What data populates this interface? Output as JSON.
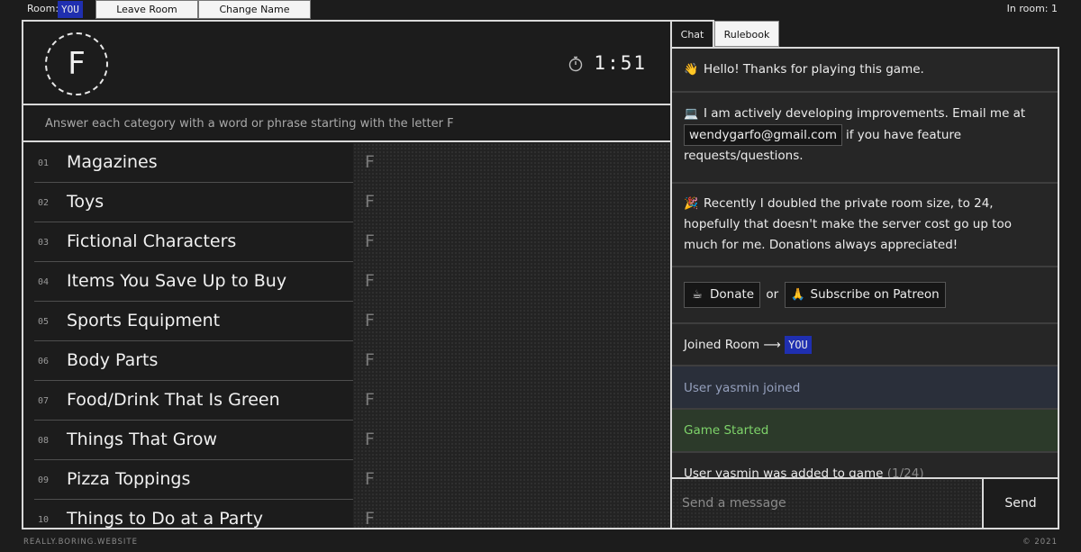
{
  "topbar": {
    "room_label": "Room:",
    "room_name": "YOU",
    "leave_label": "Leave Room",
    "change_name_label": "Change Name",
    "in_room": "In room: 1"
  },
  "game": {
    "letter": "F",
    "timer": "1:51",
    "instructions": "Answer each category with a word or phrase starting with the letter F",
    "categories": [
      {
        "num": "01",
        "name": "Magazines",
        "answer": "F"
      },
      {
        "num": "02",
        "name": "Toys",
        "answer": "F"
      },
      {
        "num": "03",
        "name": "Fictional Characters",
        "answer": "F"
      },
      {
        "num": "04",
        "name": "Items You Save Up to Buy",
        "answer": "F"
      },
      {
        "num": "05",
        "name": "Sports Equipment",
        "answer": "F"
      },
      {
        "num": "06",
        "name": "Body Parts",
        "answer": "F"
      },
      {
        "num": "07",
        "name": "Food/Drink That Is Green",
        "answer": "F"
      },
      {
        "num": "08",
        "name": "Things That Grow",
        "answer": "F"
      },
      {
        "num": "09",
        "name": "Pizza Toppings",
        "answer": "F"
      },
      {
        "num": "10",
        "name": "Things to Do at a Party",
        "answer": "F"
      }
    ]
  },
  "tabs": {
    "chat": "Chat",
    "rulebook": "Rulebook"
  },
  "chat": {
    "hello": "Hello! Thanks for playing this game.",
    "dev_before": "I am actively developing improvements. Email me at",
    "email": "wendygarfo@gmail.com",
    "dev_after": "if you have feature requests/questions.",
    "room_size": "Recently I doubled the private room size, to 24, hopefully that doesn't make the server cost go up too much for me. Donations always appreciated!",
    "donate_label": "Donate",
    "or_text": "or",
    "patreon_label": "Subscribe on Patreon",
    "joined_room": "Joined Room ⟶",
    "joined_room_name": "YOU",
    "user_joined": "User yasmin joined",
    "game_started": "Game Started",
    "user_added": "User yasmin was added to game",
    "user_added_count": "(1/24)"
  },
  "composer": {
    "placeholder": "Send a message",
    "send_label": "Send"
  },
  "footer": {
    "site": "REALLY.BORING.WEBSITE",
    "copyright": "© 2021"
  },
  "colors": {
    "accent_blue": "#1f2fb0",
    "game_started_green": "#7ed36a",
    "joined_blue_gray": "#95a0bd"
  }
}
